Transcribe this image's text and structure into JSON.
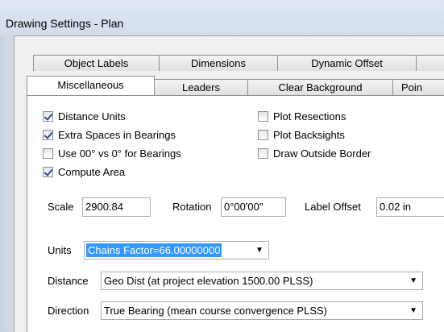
{
  "window": {
    "title": "Drawing Settings - Plan"
  },
  "tabs_back": [
    {
      "label": "Object Labels"
    },
    {
      "label": "Dimensions"
    },
    {
      "label": "Dynamic Offset"
    },
    {
      "label": ""
    }
  ],
  "tabs_front": [
    {
      "label": "Miscellaneous",
      "active": true
    },
    {
      "label": "Leaders"
    },
    {
      "label": "Clear Background"
    },
    {
      "label": "Poin"
    }
  ],
  "checkboxes": [
    {
      "label": "Distance Units",
      "checked": true
    },
    {
      "label": "Extra Spaces in Bearings",
      "checked": true
    },
    {
      "label": "Use 00° vs 0° for Bearings",
      "checked": false
    },
    {
      "label": "Compute Area",
      "checked": true
    },
    {
      "label": "Plot Resections",
      "checked": false
    },
    {
      "label": "Plot Backsights",
      "checked": false
    },
    {
      "label": "Draw Outside Border",
      "checked": false
    }
  ],
  "scale": {
    "label": "Scale",
    "value": "2900.84"
  },
  "rotation": {
    "label": "Rotation",
    "value": "0°00'00\""
  },
  "label_offset": {
    "label": "Label Offset",
    "value": "0.02 in"
  },
  "units": {
    "label": "Units",
    "value": "Chains  Factor=66.00000000"
  },
  "distance": {
    "label": "Distance",
    "value": "Geo Dist (at project elevation 1500.00 PLSS)"
  },
  "direction": {
    "label": "Direction",
    "value": "True Bearing (mean course convergence PLSS)"
  },
  "icons": {
    "dropdown": "chevron-down-icon",
    "check": "check-icon"
  },
  "colors": {
    "selection": "#3399ff",
    "check": "#2b4e8e",
    "titlebar": "#d2dde9"
  }
}
